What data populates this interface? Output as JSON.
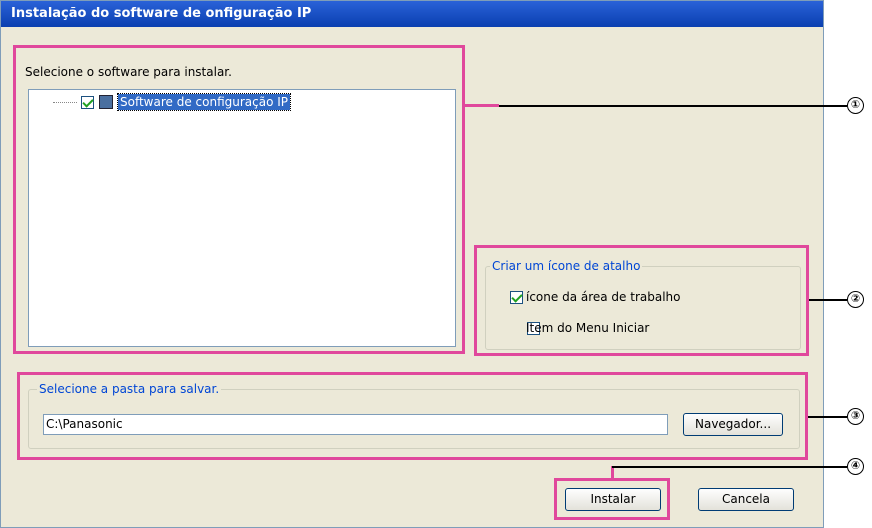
{
  "window": {
    "title": "Instalação do software de onfiguração IP"
  },
  "software": {
    "label": "Selecione o software para instalar.",
    "tree_items": [
      {
        "label": "Software de configuração IP",
        "checked": true
      }
    ]
  },
  "shortcut": {
    "legend": "Criar um ícone de atalho",
    "options": [
      {
        "label": "ícone da área de trabalho",
        "checked": true
      },
      {
        "label": "Item do Menu Iniciar",
        "checked": false
      }
    ]
  },
  "folder": {
    "legend": "Selecione a pasta para salvar.",
    "path_value": "C:\\Panasonic",
    "browse_label": "Navegador..."
  },
  "buttons": {
    "install_label": "Instalar",
    "cancel_label": "Cancela"
  },
  "callouts": [
    "①",
    "②",
    "③",
    "④"
  ],
  "colors": {
    "highlight": "#e0489c",
    "titlebar": "#0a3fb0",
    "selection": "#316ac5"
  }
}
